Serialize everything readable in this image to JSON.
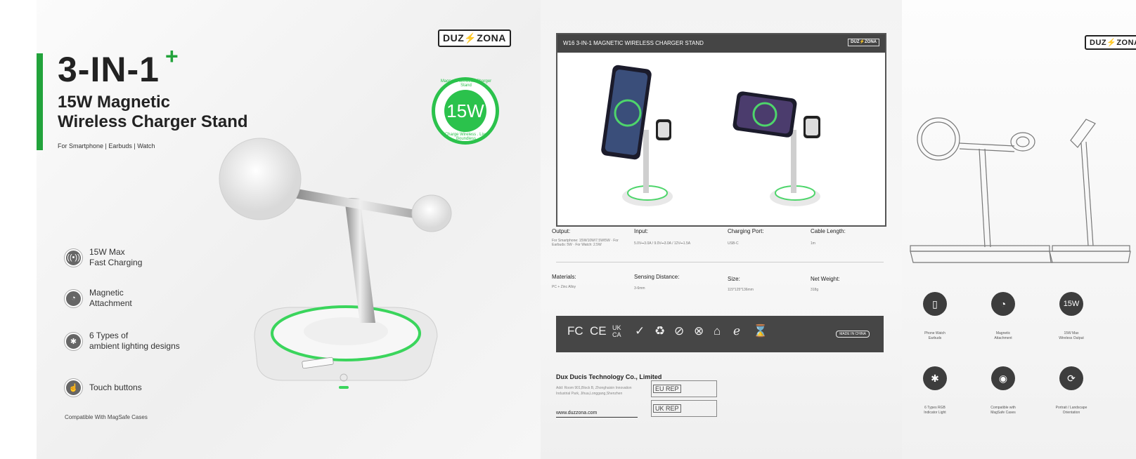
{
  "brand": {
    "left": "DUZ",
    "right": "ZONA"
  },
  "front": {
    "title": "3-IN-1",
    "plus": "+",
    "subtitle_line1": "15W Magnetic",
    "subtitle_line2": "Wireless Charger Stand",
    "for_line": "For Smartphone | Earbuds | Watch",
    "badge": {
      "center": "15W",
      "ring_top": "Magnetic Wireless Charger Stand",
      "ring_bottom": "Charge Wireless . Live Boundless"
    },
    "features": [
      {
        "icon": "fast-charge-icon",
        "line1": "15W Max",
        "line2": "Fast Charging"
      },
      {
        "icon": "magnet-icon",
        "line1": "Magnetic",
        "line2": "Attachment"
      },
      {
        "icon": "light-icon",
        "line1": "6 Types of",
        "line2": "ambient lighting designs"
      },
      {
        "icon": "touch-icon",
        "line1": "Touch buttons",
        "line2": ""
      }
    ],
    "compat": "Compatible With MagSafe Cases"
  },
  "back": {
    "header": "W16 3-IN-1 MAGNETIC WIRELESS CHARGER STAND",
    "specs_row1": [
      {
        "label": "Output:",
        "value": "For Smartphone: 15W/10W/7.5W/5W · For Earbuds: 5W · For Watch: 2.5W"
      },
      {
        "label": "Input:",
        "value": "5.0V⎓3.0A / 9.0V⎓3.0A / 12V⎓1.5A"
      },
      {
        "label": "Charging Port:",
        "value": "USB-C"
      },
      {
        "label": "Cable Length:",
        "value": "1m"
      }
    ],
    "specs_row2": [
      {
        "label": "Materials:",
        "value": "PC + Zinc Alloy"
      },
      {
        "label": "Sensing Distance:",
        "value": "3-6mm"
      },
      {
        "label": "Size:",
        "value": "115*125*136mm"
      },
      {
        "label": "Net Weight:",
        "value": "318g"
      }
    ],
    "cert_marks": [
      "FC",
      "CE",
      "UK CA",
      "✓",
      "♻",
      "⊘",
      "⊗",
      "⌂",
      "ℯ",
      "⌛"
    ],
    "made_in": "MADE IN CHINA",
    "company": "Dux Ducis Technology Co., Limited",
    "address": "Add: Room 901,Block B, Zhonghaixin Innovation Industrial Park, Jihua,Longgang,Shenzhen",
    "website": "www.duzzona.com",
    "eu_rep": "EU REP",
    "uk_rep": "UK REP"
  },
  "side": {
    "features": [
      {
        "icon": "phone-watch-icon",
        "glyph": "▯",
        "line1": "Phone Watch",
        "line2": "Earbuds"
      },
      {
        "icon": "magnet-icon",
        "glyph": "◔",
        "line1": "Magnetic",
        "line2": "Attachment"
      },
      {
        "icon": "power-icon",
        "glyph": "15W",
        "line1": "15W Max",
        "line2": "Wireless Output"
      },
      {
        "icon": "light-icon",
        "glyph": "✱",
        "line1": "6 Types RGB",
        "line2": "Indicator Light"
      },
      {
        "icon": "magsafe-icon",
        "glyph": "◉",
        "line1": "Compatible with",
        "line2": "MagSafe Cases"
      },
      {
        "icon": "rotate-icon",
        "glyph": "⟳",
        "line1": "Portrait / Landscape",
        "line2": "Orientation"
      }
    ]
  },
  "colors": {
    "accent": "#22a33b",
    "glow": "#2bc24c",
    "dark": "#454545"
  }
}
